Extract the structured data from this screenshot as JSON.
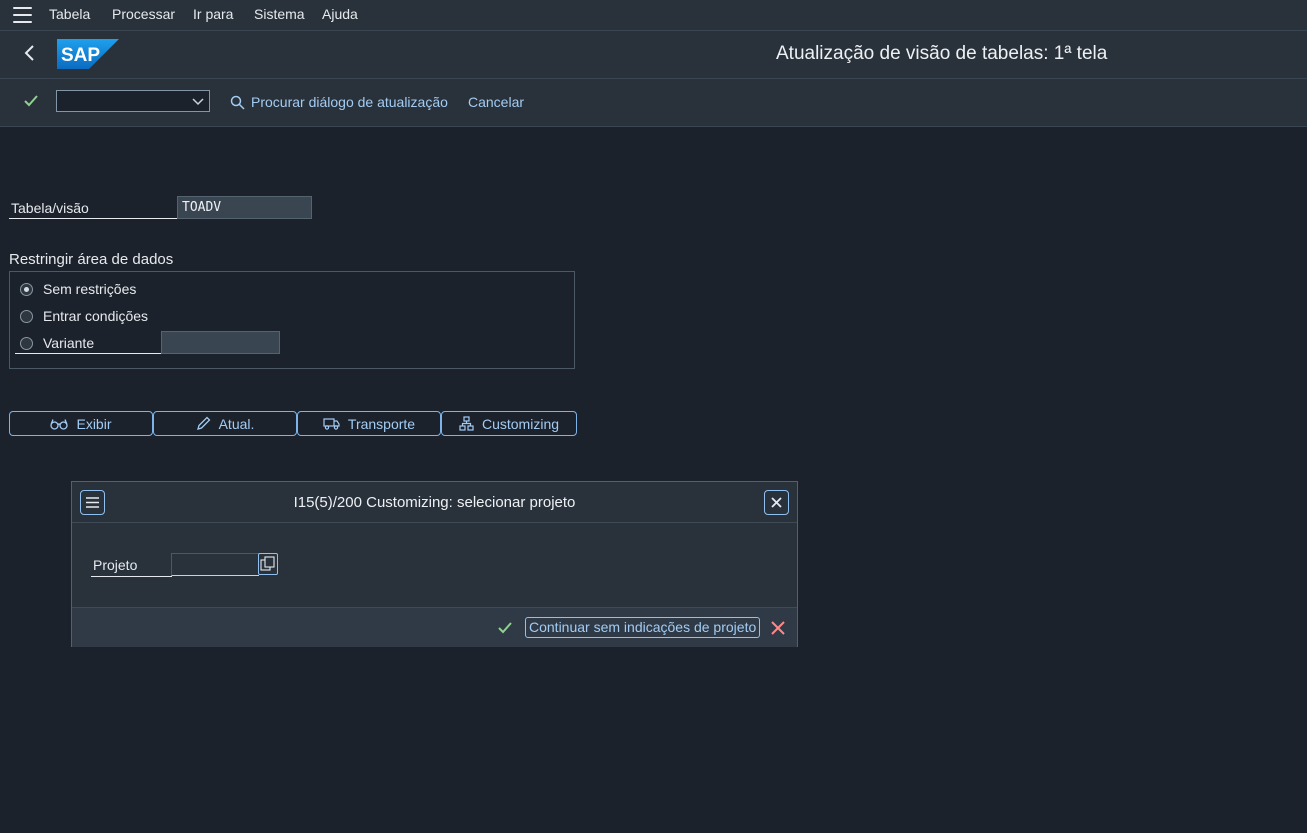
{
  "menubar": {
    "items": [
      "Tabela",
      "Processar",
      "Ir para",
      "Sistema",
      "Ajuda"
    ]
  },
  "header": {
    "logo_text": "SAP",
    "title": "Atualização de visão de tabelas: 1ª tela"
  },
  "toolbar": {
    "command_value": "",
    "find_label": "Procurar diálogo de atualização",
    "cancel_label": "Cancelar"
  },
  "form": {
    "table_label": "Tabela/visão",
    "table_value": "TOADV",
    "restrict_title": "Restringir área de dados",
    "options": [
      "Sem restrições",
      "Entrar condições",
      "Variante"
    ],
    "selected_option": "Sem restrições",
    "variant_value": ""
  },
  "actions": {
    "display_label": "Exibir",
    "update_label": "Atual.",
    "transport_label": "Transporte",
    "customizing_label": "Customizing"
  },
  "dialog": {
    "title": "I15(5)/200 Customizing: selecionar projeto",
    "project_label": "Projeto",
    "project_value": "",
    "continue_label": "Continuar sem indicações de projeto"
  },
  "colors": {
    "background": "#1c222b",
    "bar": "#29313a",
    "accent": "#a3ccf4",
    "ok_green": "#8fd18e",
    "cancel_red": "#ff8888",
    "sap_blue": "#0a84d6"
  }
}
